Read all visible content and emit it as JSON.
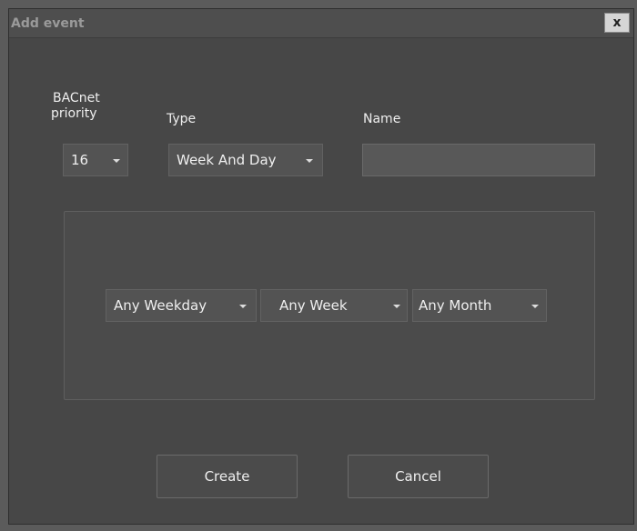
{
  "dialog": {
    "title": "Add event",
    "close_label": "x"
  },
  "form": {
    "priority": {
      "label_line1": "BACnet",
      "label_line2": "priority",
      "value": "16"
    },
    "type": {
      "label": "Type",
      "value": "Week And Day"
    },
    "name": {
      "label": "Name",
      "value": ""
    }
  },
  "schedule": {
    "weekday": "Any Weekday",
    "week": "Any Week",
    "month": "Any Month"
  },
  "buttons": {
    "create": "Create",
    "cancel": "Cancel"
  },
  "icons": {
    "dropdown": "chevron-down-icon",
    "close": "close-icon"
  },
  "colors": {
    "dialog_bg": "#474747",
    "field_bg": "#535353",
    "title_text": "#9a9a9a"
  }
}
